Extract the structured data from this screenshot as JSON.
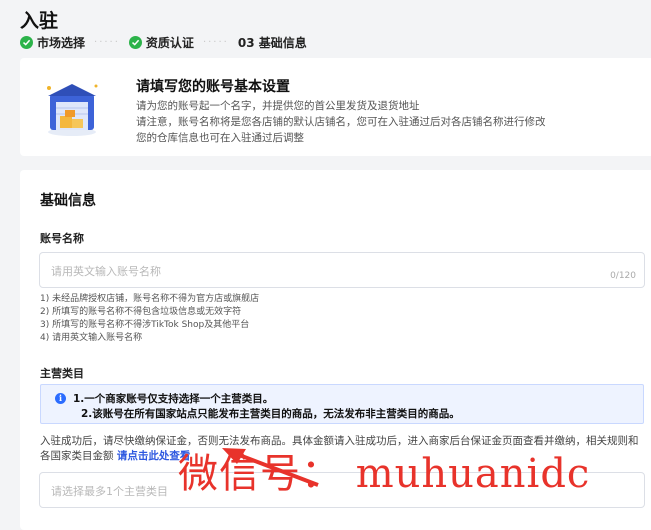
{
  "page": {
    "title": "入驻"
  },
  "steps": [
    {
      "label": "市场选择",
      "state": "done"
    },
    {
      "label": "资质认证",
      "state": "done"
    },
    {
      "label": "03 基础信息",
      "state": "current"
    }
  ],
  "intro": {
    "heading": "请填写您的账号基本设置",
    "lines": [
      "请为您的账号起一个名字，并提供您的首公里发货及退货地址",
      "请注意，账号名称将是您各店铺的默认店铺名，您可在入驻通过后对各店铺名称进行修改",
      "您的仓库信息也可在入驻通过后调整"
    ]
  },
  "basic": {
    "section_title": "基础信息",
    "account_label": "账号名称",
    "account_placeholder": "请用英文输入账号名称",
    "account_counter": "0/120",
    "rules": [
      "1) 未经品牌授权店铺，账号名称不得为官方店或旗舰店",
      "2) 所填写的账号名称不得包含垃圾信息或无效字符",
      "3) 所填写的账号名称不得涉TikTok Shop及其他平台",
      "4) 请用英文输入账号名称"
    ]
  },
  "category": {
    "label": "主营类目",
    "notice_lines": [
      "1.一个商家账号仅支持选择一个主营类目。",
      "2.该账号在所有国家站点只能发布主营类目的商品，无法发布非主营类目的商品。"
    ],
    "description": "入驻成功后，请尽快缴纳保证金，否则无法发布商品。具体金额请入驻成功后，进入商家后台保证金页面查看并缴纳，相关规则和各国家类目金额 ",
    "link_text": "请点击此处查看",
    "select_placeholder": "请选择最多1个主营类目"
  },
  "watermark": {
    "text": "微信号： muhuanidc"
  },
  "colors": {
    "success": "#2cb34a",
    "link": "#2e58e0",
    "watermark": "#e8332b",
    "notice_bg": "#eef3ff"
  }
}
